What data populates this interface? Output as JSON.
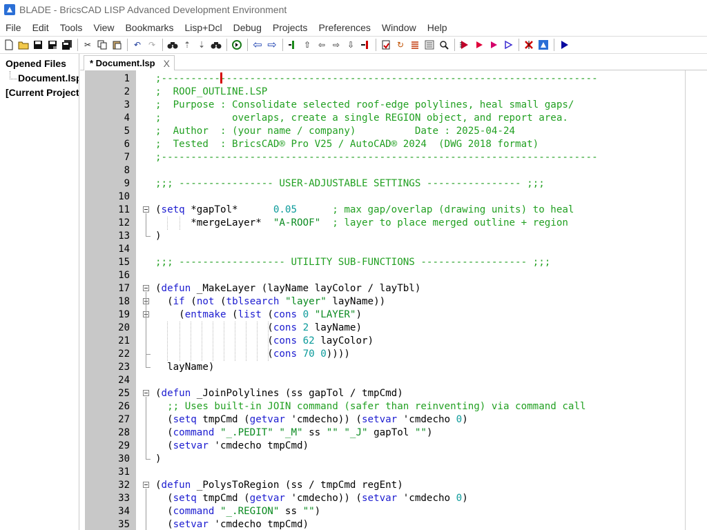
{
  "window": {
    "title": "BLADE - BricsCAD LISP Advanced Development Environment"
  },
  "menu": [
    "File",
    "Edit",
    "Tools",
    "View",
    "Bookmarks",
    "Lisp+Dcl",
    "Debug",
    "Projects",
    "Preferences",
    "Window",
    "Help"
  ],
  "toolbar": {
    "buttons": [
      "new-file-icon",
      "open-folder-icon",
      "save-icon",
      "save-as-icon",
      "save-all-icon",
      "cut-icon",
      "copy-icon",
      "paste-icon",
      "undo-icon",
      "redo-icon",
      "find-icon",
      "find-up-icon",
      "find-down-icon",
      "find-in-files-icon",
      "goto-icon",
      "back-icon",
      "forward-icon",
      "add-bookmark-icon",
      "step-up-icon",
      "step-left-icon",
      "step-right-icon",
      "step-down-icon",
      "exit-icon",
      "load-icon",
      "format-icon",
      "comment-icon",
      "list-icon",
      "zoom-icon",
      "run-icon",
      "run-selection-icon",
      "start-debug-icon",
      "continue-icon",
      "stop-icon",
      "bricscad-icon",
      "play-icon"
    ]
  },
  "sidebar": {
    "root1": "Opened Files",
    "child": "Document.lsp",
    "root2": "[Current Project]"
  },
  "tab": {
    "label": "* Document.lsp",
    "close": "X"
  },
  "code_lines": [
    {
      "n": "1",
      "tokens": [
        {
          "t": ";--------------------------------------------------------------------------",
          "c": "c-comment"
        }
      ]
    },
    {
      "n": "2",
      "tokens": [
        {
          "t": ";  ROOF_OUTLINE.LSP",
          "c": "c-comment"
        }
      ]
    },
    {
      "n": "3",
      "tokens": [
        {
          "t": ";  Purpose : Consolidate selected roof‐edge polylines, heal small gaps/",
          "c": "c-comment"
        }
      ]
    },
    {
      "n": "4",
      "tokens": [
        {
          "t": ";            overlaps, create a single REGION object, and report area.",
          "c": "c-comment"
        }
      ]
    },
    {
      "n": "5",
      "tokens": [
        {
          "t": ";  Author  : (your name / company)          Date : 2025‐04‐24",
          "c": "c-comment"
        }
      ]
    },
    {
      "n": "6",
      "tokens": [
        {
          "t": ";  Tested  : BricsCAD® Pro V25 / AutoCAD® 2024  (DWG 2018 format)",
          "c": "c-comment"
        }
      ]
    },
    {
      "n": "7",
      "tokens": [
        {
          "t": ";--------------------------------------------------------------------------",
          "c": "c-comment"
        }
      ]
    },
    {
      "n": "8",
      "tokens": []
    },
    {
      "n": "9",
      "tokens": [
        {
          "t": ";;; ---------------- USER‐ADJUSTABLE SETTINGS ---------------- ;;;",
          "c": "c-comment"
        }
      ]
    },
    {
      "n": "10",
      "tokens": []
    },
    {
      "n": "11",
      "tokens": [
        {
          "t": "(",
          "c": ""
        },
        {
          "t": "setq",
          "c": "c-kw"
        },
        {
          "t": " *gapTol*      ",
          "c": ""
        },
        {
          "t": "0.05",
          "c": "c-num"
        },
        {
          "t": "      ",
          "c": ""
        },
        {
          "t": "; max gap/overlap (drawing units) to heal",
          "c": "c-comment"
        }
      ]
    },
    {
      "n": "12",
      "tokens": [
        {
          "t": "      *mergeLayer*  ",
          "c": ""
        },
        {
          "t": "\"A-ROOF\"",
          "c": "c-str"
        },
        {
          "t": "  ",
          "c": ""
        },
        {
          "t": "; layer to place merged outline + region",
          "c": "c-comment"
        }
      ]
    },
    {
      "n": "13",
      "tokens": [
        {
          "t": ")",
          "c": ""
        }
      ]
    },
    {
      "n": "14",
      "tokens": []
    },
    {
      "n": "15",
      "tokens": [
        {
          "t": ";;; ------------------ UTILITY SUB‐FUNCTIONS ------------------ ;;;",
          "c": "c-comment"
        }
      ]
    },
    {
      "n": "16",
      "tokens": []
    },
    {
      "n": "17",
      "tokens": [
        {
          "t": "(",
          "c": ""
        },
        {
          "t": "defun",
          "c": "c-kw"
        },
        {
          "t": " _MakeLayer (layName layColor / layTbl)",
          "c": ""
        }
      ]
    },
    {
      "n": "18",
      "tokens": [
        {
          "t": "  (",
          "c": ""
        },
        {
          "t": "if",
          "c": "c-kw"
        },
        {
          "t": " (",
          "c": ""
        },
        {
          "t": "not",
          "c": "c-kw"
        },
        {
          "t": " (",
          "c": ""
        },
        {
          "t": "tblsearch",
          "c": "c-kw"
        },
        {
          "t": " ",
          "c": ""
        },
        {
          "t": "\"layer\"",
          "c": "c-str"
        },
        {
          "t": " layName))",
          "c": ""
        }
      ]
    },
    {
      "n": "19",
      "tokens": [
        {
          "t": "    (",
          "c": ""
        },
        {
          "t": "entmake",
          "c": "c-kw"
        },
        {
          "t": " (",
          "c": ""
        },
        {
          "t": "list",
          "c": "c-kw"
        },
        {
          "t": " (",
          "c": ""
        },
        {
          "t": "cons",
          "c": "c-kw"
        },
        {
          "t": " ",
          "c": ""
        },
        {
          "t": "0",
          "c": "c-num"
        },
        {
          "t": " ",
          "c": ""
        },
        {
          "t": "\"LAYER\"",
          "c": "c-str"
        },
        {
          "t": ")",
          "c": ""
        }
      ]
    },
    {
      "n": "20",
      "tokens": [
        {
          "t": "                   (",
          "c": ""
        },
        {
          "t": "cons",
          "c": "c-kw"
        },
        {
          "t": " ",
          "c": ""
        },
        {
          "t": "2",
          "c": "c-num"
        },
        {
          "t": " layName)",
          "c": ""
        }
      ]
    },
    {
      "n": "21",
      "tokens": [
        {
          "t": "                   (",
          "c": ""
        },
        {
          "t": "cons",
          "c": "c-kw"
        },
        {
          "t": " ",
          "c": ""
        },
        {
          "t": "62",
          "c": "c-num"
        },
        {
          "t": " layColor)",
          "c": ""
        }
      ]
    },
    {
      "n": "22",
      "tokens": [
        {
          "t": "                   (",
          "c": ""
        },
        {
          "t": "cons",
          "c": "c-kw"
        },
        {
          "t": " ",
          "c": ""
        },
        {
          "t": "70",
          "c": "c-num"
        },
        {
          "t": " ",
          "c": ""
        },
        {
          "t": "0",
          "c": "c-num"
        },
        {
          "t": "))))",
          "c": ""
        }
      ]
    },
    {
      "n": "23",
      "tokens": [
        {
          "t": "  layName)",
          "c": ""
        }
      ]
    },
    {
      "n": "24",
      "tokens": []
    },
    {
      "n": "25",
      "tokens": [
        {
          "t": "(",
          "c": ""
        },
        {
          "t": "defun",
          "c": "c-kw"
        },
        {
          "t": " _JoinPolylines (ss gapTol / tmpCmd)",
          "c": ""
        }
      ]
    },
    {
      "n": "26",
      "tokens": [
        {
          "t": "  ",
          "c": ""
        },
        {
          "t": ";; Uses built‐in JOIN command (safer than reinventing) via command call",
          "c": "c-comment"
        }
      ]
    },
    {
      "n": "27",
      "tokens": [
        {
          "t": "  (",
          "c": ""
        },
        {
          "t": "setq",
          "c": "c-kw"
        },
        {
          "t": " tmpCmd (",
          "c": ""
        },
        {
          "t": "getvar",
          "c": "c-kw"
        },
        {
          "t": " 'cmdecho)) (",
          "c": ""
        },
        {
          "t": "setvar",
          "c": "c-kw"
        },
        {
          "t": " 'cmdecho ",
          "c": ""
        },
        {
          "t": "0",
          "c": "c-num"
        },
        {
          "t": ")",
          "c": ""
        }
      ]
    },
    {
      "n": "28",
      "tokens": [
        {
          "t": "  (",
          "c": ""
        },
        {
          "t": "command",
          "c": "c-kw"
        },
        {
          "t": " ",
          "c": ""
        },
        {
          "t": "\"_.PEDIT\"",
          "c": "c-str"
        },
        {
          "t": " ",
          "c": ""
        },
        {
          "t": "\"_M\"",
          "c": "c-str"
        },
        {
          "t": " ss ",
          "c": ""
        },
        {
          "t": "\"\"",
          "c": "c-str"
        },
        {
          "t": " ",
          "c": ""
        },
        {
          "t": "\"_J\"",
          "c": "c-str"
        },
        {
          "t": " gapTol ",
          "c": ""
        },
        {
          "t": "\"\"",
          "c": "c-str"
        },
        {
          "t": ")",
          "c": ""
        }
      ]
    },
    {
      "n": "29",
      "tokens": [
        {
          "t": "  (",
          "c": ""
        },
        {
          "t": "setvar",
          "c": "c-kw"
        },
        {
          "t": " 'cmdecho tmpCmd)",
          "c": ""
        }
      ]
    },
    {
      "n": "30",
      "tokens": [
        {
          "t": ")",
          "c": ""
        }
      ]
    },
    {
      "n": "31",
      "tokens": []
    },
    {
      "n": "32",
      "tokens": [
        {
          "t": "(",
          "c": ""
        },
        {
          "t": "defun",
          "c": "c-kw"
        },
        {
          "t": " _PolysToRegion (ss / tmpCmd regEnt)",
          "c": ""
        }
      ]
    },
    {
      "n": "33",
      "tokens": [
        {
          "t": "  (",
          "c": ""
        },
        {
          "t": "setq",
          "c": "c-kw"
        },
        {
          "t": " tmpCmd (",
          "c": ""
        },
        {
          "t": "getvar",
          "c": "c-kw"
        },
        {
          "t": " 'cmdecho)) (",
          "c": ""
        },
        {
          "t": "setvar",
          "c": "c-kw"
        },
        {
          "t": " 'cmdecho ",
          "c": ""
        },
        {
          "t": "0",
          "c": "c-num"
        },
        {
          "t": ")",
          "c": ""
        }
      ]
    },
    {
      "n": "34",
      "tokens": [
        {
          "t": "  (",
          "c": ""
        },
        {
          "t": "command",
          "c": "c-kw"
        },
        {
          "t": " ",
          "c": ""
        },
        {
          "t": "\"_.REGION\"",
          "c": "c-str"
        },
        {
          "t": " ss ",
          "c": ""
        },
        {
          "t": "\"\"",
          "c": "c-str"
        },
        {
          "t": ")",
          "c": ""
        }
      ]
    },
    {
      "n": "35",
      "tokens": [
        {
          "t": "  (",
          "c": ""
        },
        {
          "t": "setvar",
          "c": "c-kw"
        },
        {
          "t": " 'cmdecho tmpCmd)",
          "c": ""
        }
      ]
    }
  ],
  "colors": {
    "comment": "#22a022",
    "keyword": "#1c1cd0",
    "number": "#0a9a9a",
    "string": "#0a8a20",
    "gutter": "#c8c8c8",
    "caret": "#d40000"
  }
}
